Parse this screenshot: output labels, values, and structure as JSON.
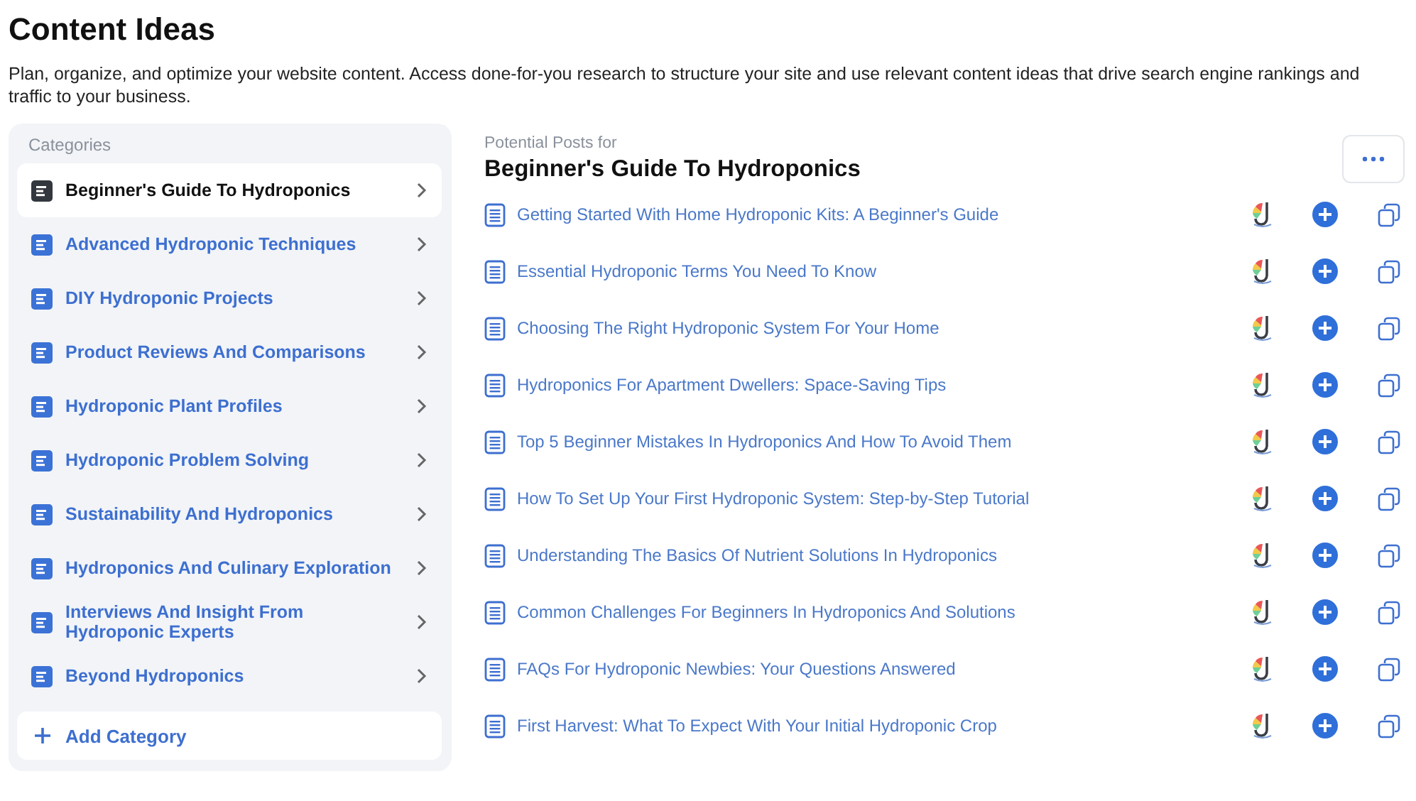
{
  "page": {
    "title": "Content Ideas",
    "description": "Plan, organize, and optimize your website content. Access done-for-you research to structure your site and use relevant content ideas that drive search engine rankings and traffic to your business."
  },
  "sidebar": {
    "heading": "Categories",
    "items": [
      {
        "label": "Beginner's Guide To Hydroponics",
        "selected": true
      },
      {
        "label": "Advanced Hydroponic Techniques",
        "selected": false
      },
      {
        "label": "DIY Hydroponic Projects",
        "selected": false
      },
      {
        "label": "Product Reviews And Comparisons",
        "selected": false
      },
      {
        "label": "Hydroponic Plant Profiles",
        "selected": false
      },
      {
        "label": "Hydroponic Problem Solving",
        "selected": false
      },
      {
        "label": "Sustainability And Hydroponics",
        "selected": false
      },
      {
        "label": "Hydroponics And Culinary Exploration",
        "selected": false
      },
      {
        "label": "Interviews And Insight From Hydroponic Experts",
        "selected": false
      },
      {
        "label": "Beyond Hydroponics",
        "selected": false
      }
    ],
    "add_button": "Add Category"
  },
  "posts": {
    "subtitle": "Potential Posts for",
    "title": "Beginner's Guide To Hydroponics",
    "items": [
      "Getting Started With Home Hydroponic Kits: A Beginner's Guide",
      "Essential Hydroponic Terms You Need To Know",
      "Choosing The Right Hydroponic System For Your Home",
      "Hydroponics For Apartment Dwellers: Space-Saving Tips",
      "Top 5 Beginner Mistakes In Hydroponics And How To Avoid Them",
      "How To Set Up Your First Hydroponic System: Step-by-Step Tutorial",
      "Understanding The Basics Of Nutrient Solutions In Hydroponics",
      "Common Challenges For Beginners In Hydroponics And Solutions",
      "FAQs For Hydroponic Newbies: Your Questions Answered",
      "First Harvest: What To Expect With Your Initial Hydroponic Crop"
    ]
  }
}
